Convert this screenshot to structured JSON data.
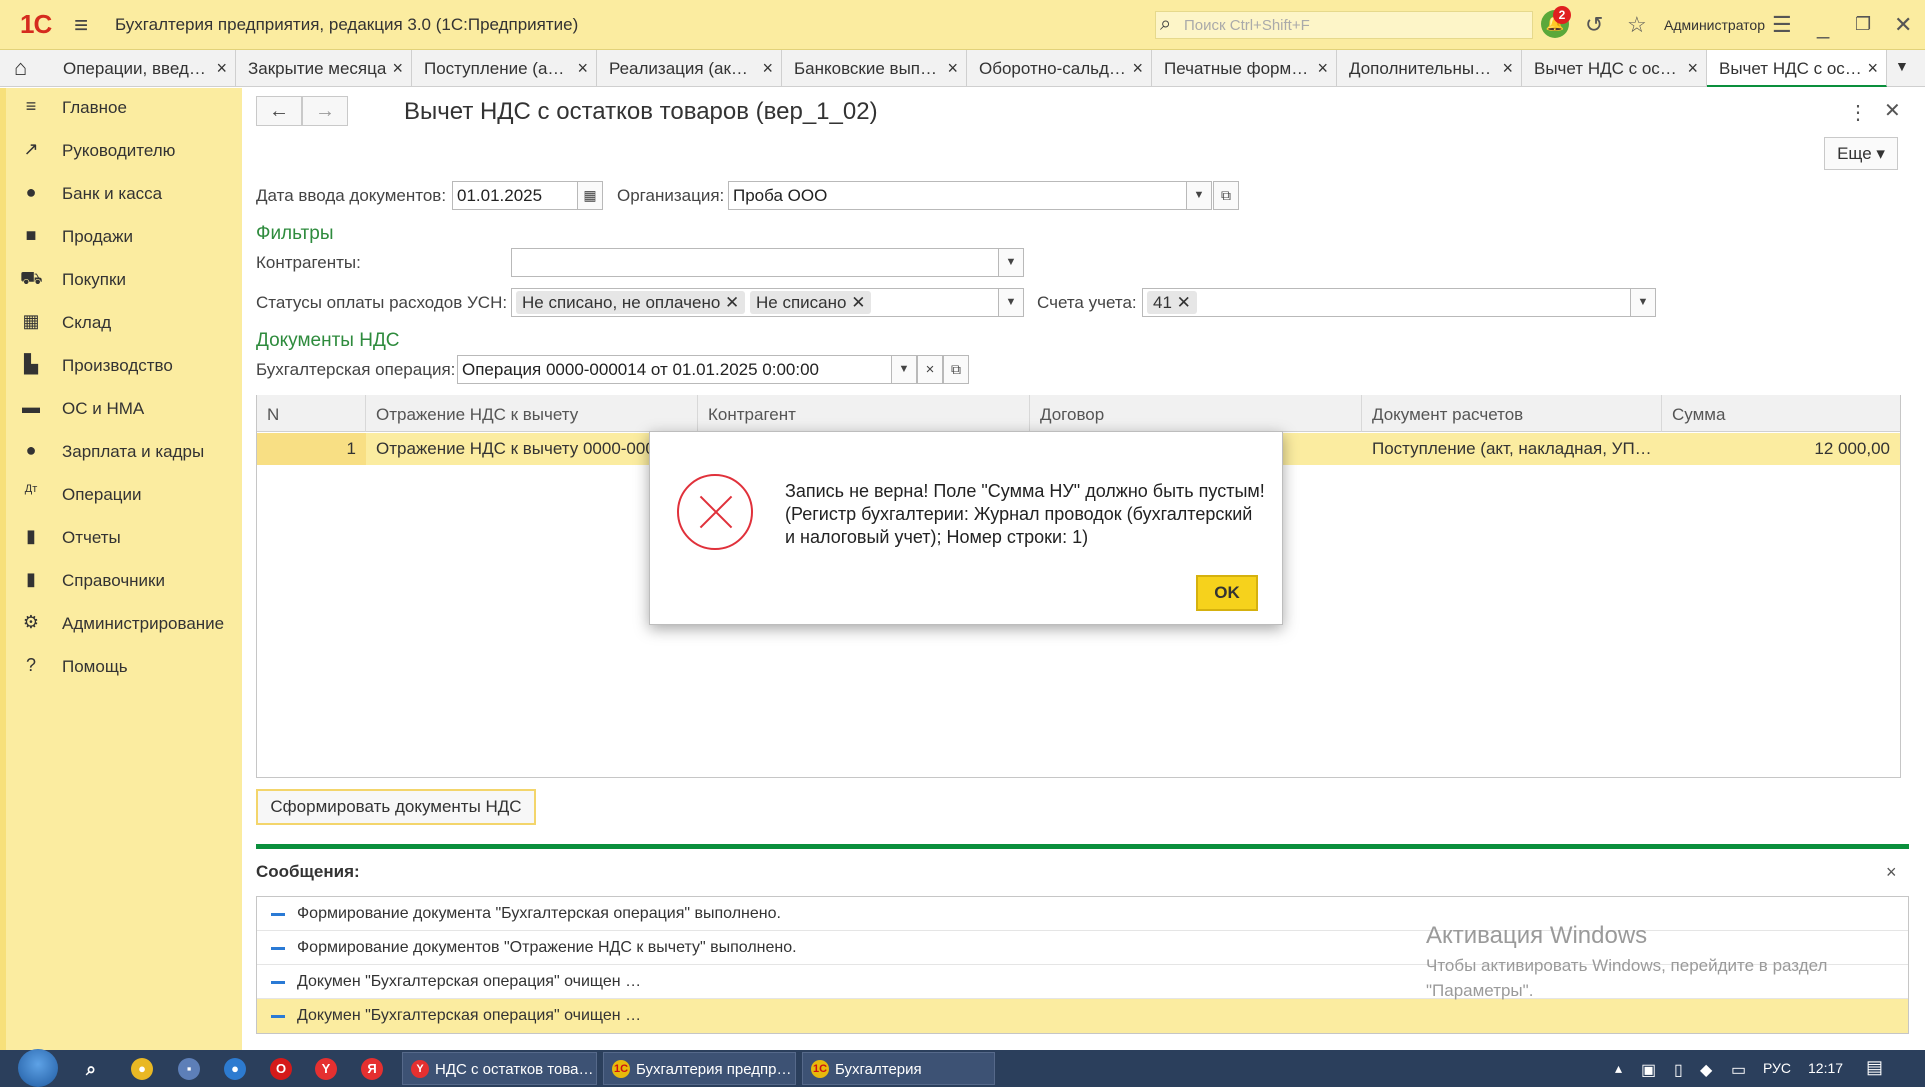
{
  "app": {
    "title": "Бухгалтерия предприятия, редакция 3.0  (1С:Предприятие)",
    "logo": "1С",
    "search_placeholder": "Поиск Ctrl+Shift+F",
    "notifications": "2",
    "user": "Администратор"
  },
  "tabs": [
    {
      "label": "Операции, введ…"
    },
    {
      "label": "Закрытие месяца"
    },
    {
      "label": "Поступление (а…"
    },
    {
      "label": "Реализация (ак…"
    },
    {
      "label": "Банковские вып…"
    },
    {
      "label": "Оборотно-сальд…"
    },
    {
      "label": "Печатные форм…"
    },
    {
      "label": "Дополнительны…"
    },
    {
      "label": "Вычет НДС с ос…"
    },
    {
      "label": "Вычет НДС с ос…"
    }
  ],
  "sidebar": {
    "items": [
      {
        "label": "Главное",
        "icon": "menu-icon"
      },
      {
        "label": "Руководителю",
        "icon": "trend-icon"
      },
      {
        "label": "Банк и касса",
        "icon": "ruble-icon"
      },
      {
        "label": "Продажи",
        "icon": "bag-icon"
      },
      {
        "label": "Покупки",
        "icon": "cart-icon"
      },
      {
        "label": "Склад",
        "icon": "warehouse-icon"
      },
      {
        "label": "Производство",
        "icon": "factory-icon"
      },
      {
        "label": "ОС и НМА",
        "icon": "truck-icon"
      },
      {
        "label": "Зарплата и кадры",
        "icon": "person-icon"
      },
      {
        "label": "Операции",
        "icon": "dt-kt-icon"
      },
      {
        "label": "Отчеты",
        "icon": "bar-chart-icon"
      },
      {
        "label": "Справочники",
        "icon": "book-icon"
      },
      {
        "label": "Администрирование",
        "icon": "gear-icon"
      },
      {
        "label": "Помощь",
        "icon": "question-icon"
      }
    ]
  },
  "document": {
    "title": "Вычет НДС с остатков товаров (вер_1_02)",
    "more_button": "Еще",
    "date_label": "Дата ввода документов:",
    "date_value": "01.01.2025",
    "org_label": "Организация:",
    "org_value": "Проба ООО",
    "filters_title": "Фильтры",
    "counterparties_label": "Контрагенты:",
    "counterparties_value": "",
    "usn_status_label": "Статусы оплаты расходов УСН:",
    "usn_status_chips": [
      "Не списано, не оплачено",
      "Не списано"
    ],
    "accounts_label": "Счета учета:",
    "accounts_chips": [
      "41"
    ],
    "vat_docs_title": "Документы НДС",
    "operation_label": "Бухгалтерская операция:",
    "operation_value": "Операция 0000-000014 от 01.01.2025 0:00:00",
    "form_button": "Сформировать документы НДС"
  },
  "table": {
    "columns": [
      "N",
      "Отражение НДС к вычету",
      "Контрагент",
      "Договор",
      "Документ расчетов",
      "Сумма"
    ],
    "rows": [
      [
        "1",
        "Отражение НДС к вычету 0000-000",
        "",
        "",
        "Поступление (акт, накладная, УП…",
        "12 000,00"
      ]
    ]
  },
  "messages": {
    "title": "Сообщения:",
    "items": [
      "Формирование документа \"Бухгалтерская операция\" выполнено.",
      "Формирование документов \"Отражение НДС к вычету\" выполнено.",
      "Докумен \"Бухгалтерская операция\" очищен …",
      "Докумен \"Бухгалтерская операция\" очищен …"
    ]
  },
  "watermark": {
    "title": "Активация Windows",
    "line1": "Чтобы активировать Windows, перейдите в раздел",
    "line2": "\"Параметры\"."
  },
  "dialog": {
    "text": "Запись не верна! Поле \"Сумма НУ\" должно быть пустым! (Регистр бухгалтерии: Журнал проводок (бухгалтерский и налоговый учет); Номер строки: 1)",
    "ok": "OK"
  },
  "taskbar": {
    "apps": [
      {
        "label": "НДС с остатков това…"
      },
      {
        "label": "Бухгалтерия предпр…"
      },
      {
        "label": "Бухгалтерия"
      }
    ],
    "lang": "РУС",
    "time": "12:17"
  },
  "colors": {
    "accent_yellow": "#fbeca0",
    "green": "#0a8f3c",
    "error_red": "#e0313b",
    "ok_yellow": "#f6d21c"
  }
}
